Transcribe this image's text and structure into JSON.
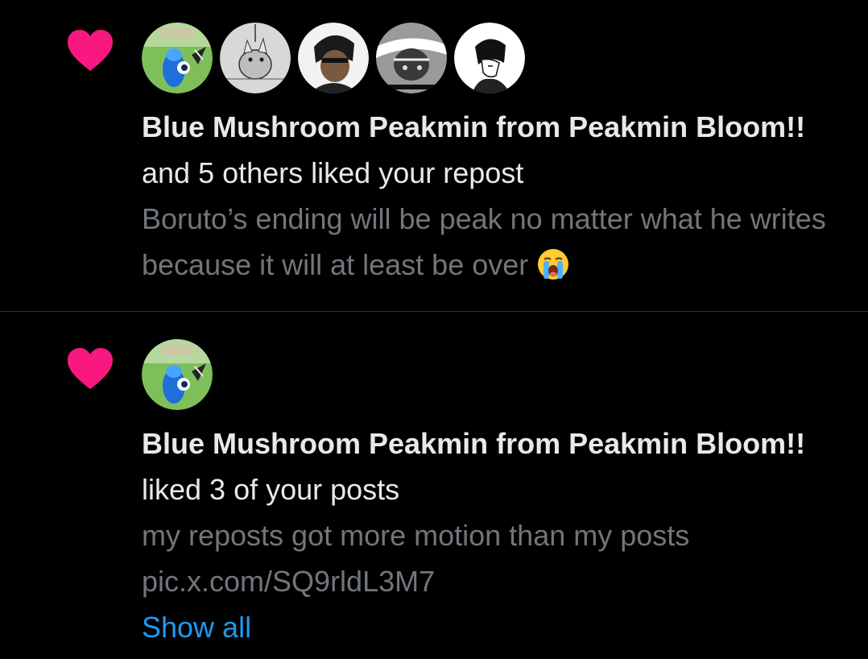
{
  "colors": {
    "background": "#000000",
    "heart": "#f91880",
    "text_primary": "#e7e9ea",
    "text_secondary": "#71767b",
    "link": "#1d9bf0",
    "divider": "#2f3336"
  },
  "notifications": [
    {
      "icon": "heart-icon",
      "avatars": [
        "avatar-blue-mushroom-peakmin",
        "avatar-bw-sketch-creature",
        "avatar-bw-manga-man",
        "avatar-bw-manga-character",
        "avatar-bw-manga-boy"
      ],
      "actor": "Blue Mushroom Peakmin from Peakmin Bloom!!",
      "action": " and 5 others liked your repost",
      "preview": "Boruto’s ending will be peak no matter what he writes because it will at least be over",
      "preview_emoji": "loudly-crying-face-icon"
    },
    {
      "icon": "heart-icon",
      "avatars": [
        "avatar-blue-mushroom-peakmin"
      ],
      "actor": "Blue Mushroom Peakmin from Peakmin Bloom!!",
      "action": " liked 3 of your posts",
      "preview": "my reposts got more motion than my posts",
      "preview_link": "pic.x.com/SQ9rldL3M7",
      "show_all_label": "Show all"
    }
  ]
}
